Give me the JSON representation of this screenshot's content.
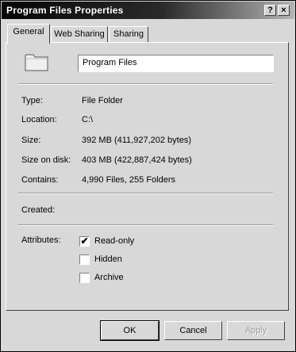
{
  "window": {
    "title": "Program Files Properties",
    "help_label": "?",
    "close_label": "×"
  },
  "tabs": [
    {
      "label": "General",
      "active": true
    },
    {
      "label": "Web Sharing",
      "active": false
    },
    {
      "label": "Sharing",
      "active": false
    }
  ],
  "general": {
    "icon": "folder-icon",
    "name_value": "Program Files",
    "rows": [
      {
        "label": "Type:",
        "value": "File Folder"
      },
      {
        "label": "Location:",
        "value": "C:\\"
      },
      {
        "label": "Size:",
        "value": "392 MB (411,927,202 bytes)"
      },
      {
        "label": "Size on disk:",
        "value": "403 MB (422,887,424 bytes)"
      },
      {
        "label": "Contains:",
        "value": "4,990 Files, 255 Folders"
      }
    ],
    "created_label": "Created:",
    "attributes_label": "Attributes:",
    "attributes": [
      {
        "label": "Read-only",
        "checked": true,
        "mark": "✔"
      },
      {
        "label": "Hidden",
        "checked": false,
        "mark": ""
      },
      {
        "label": "Archive",
        "checked": false,
        "mark": ""
      }
    ]
  },
  "buttons": {
    "ok": "OK",
    "cancel": "Cancel",
    "apply": "Apply"
  }
}
